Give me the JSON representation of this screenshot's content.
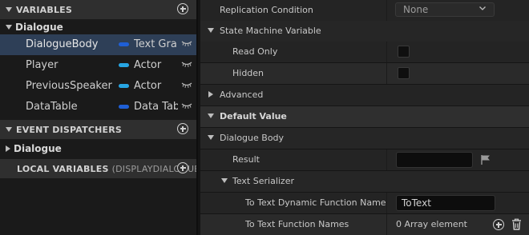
{
  "my_blueprint": {
    "variables_header": "VARIABLES",
    "category": "Dialogue",
    "variables": [
      {
        "name": "DialogueBody",
        "type": "Text Gra",
        "pin_color": "#1f5fd6",
        "selected": true
      },
      {
        "name": "Player",
        "type": "Actor",
        "pin_color": "#27a5e3",
        "selected": false
      },
      {
        "name": "PreviousSpeaker",
        "type": "Actor",
        "pin_color": "#27a5e3",
        "selected": false
      },
      {
        "name": "DataTable",
        "type": "Data Tab",
        "pin_color": "#1f5fd6",
        "selected": false
      }
    ],
    "event_dispatchers_header": "EVENT DISPATCHERS",
    "dispatcher_category": "Dialogue",
    "local_variables_header": "LOCAL VARIABLES",
    "local_variables_context": "(DISPLAYDIALOGUE"
  },
  "details": {
    "replication_condition": {
      "label": "Replication Condition",
      "value": "None"
    },
    "state_machine_variable": "State Machine Variable",
    "read_only": "Read Only",
    "hidden": "Hidden",
    "advanced": "Advanced",
    "default_value": "Default Value",
    "dialogue_body": "Dialogue Body",
    "result": {
      "label": "Result",
      "value": ""
    },
    "text_serializer": "Text Serializer",
    "to_text_dynamic": {
      "label": "To Text Dynamic Function Name",
      "value": "ToText"
    },
    "to_text_function_names": {
      "label": "To Text Function Names",
      "value": "0 Array element"
    }
  },
  "colors": {
    "selection": "#2e3f57",
    "panel_header": "#2f2f2f",
    "text_pin": "#1f5fd6",
    "object_pin": "#27a5e3"
  }
}
